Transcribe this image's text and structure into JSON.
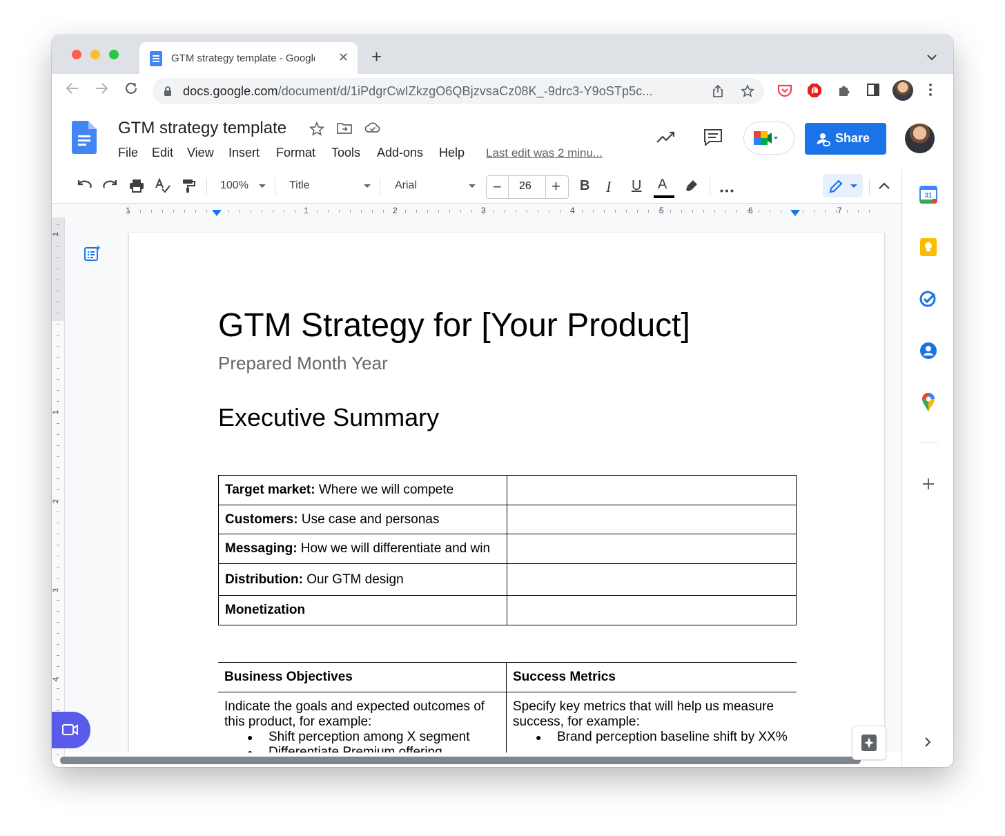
{
  "browser": {
    "tab": {
      "title": "GTM strategy template - Google Docs",
      "close": "✕"
    },
    "new_tab": "+",
    "url_host": "docs.google.com",
    "url_path": "/document/d/1iPdgrCwIZkzgO6QBjzvsaCz08K_-9drc3-Y9oSTp5c..."
  },
  "docs_header": {
    "title": "GTM strategy template",
    "menu": [
      "File",
      "Edit",
      "View",
      "Insert",
      "Format",
      "Tools",
      "Add-ons",
      "Help"
    ],
    "last_edit": "Last edit was 2 minu...",
    "share_label": "Share"
  },
  "toolbar": {
    "zoom": "100%",
    "style": "Title",
    "font": "Arial",
    "font_size": "26",
    "minus": "−",
    "plus": "+",
    "bold": "B",
    "italic": "I",
    "underline": "U",
    "text_color": "A"
  },
  "ruler": {
    "horizontal_numbers": [
      "1",
      "1",
      "2",
      "3",
      "4",
      "5",
      "6",
      "7"
    ],
    "vertical_numbers": [
      "1",
      "1",
      "2",
      "3",
      "4"
    ]
  },
  "document": {
    "title": "GTM Strategy for [Your Product]",
    "subtitle": "Prepared Month Year",
    "heading": "Executive Summary",
    "summary_table": [
      {
        "label": "Target market:",
        "text": " Where we will compete"
      },
      {
        "label": "Customers:",
        "text": " Use case and personas"
      },
      {
        "label": "Messaging:",
        "text": " How we will differentiate and win"
      },
      {
        "label": "Distribution:",
        "text": " Our GTM design"
      },
      {
        "label": "Monetization",
        "text": ""
      }
    ],
    "objectives_table": {
      "headers": [
        "Business Objectives",
        "Success Metrics"
      ],
      "left_intro": "Indicate the goals and expected outcomes of this product, for example:",
      "left_bullets": [
        "Shift perception among X segment",
        "Differentiate Premium offering"
      ],
      "right_intro": "Specify key metrics that will help us measure success, for example:",
      "right_bullets": [
        "Brand perception baseline shift by XX%"
      ]
    }
  },
  "colors": {
    "accent": "#1a73e8",
    "tab_strip": "#dee1e6",
    "meet_fab": "#5b5bea",
    "keep_yellow": "#fbbc04"
  },
  "side_panel": {
    "calendar_day": "31",
    "apps": [
      "calendar-icon",
      "keep-icon",
      "tasks-icon",
      "contacts-icon",
      "maps-icon",
      "add-icon",
      "expand-icon"
    ]
  }
}
